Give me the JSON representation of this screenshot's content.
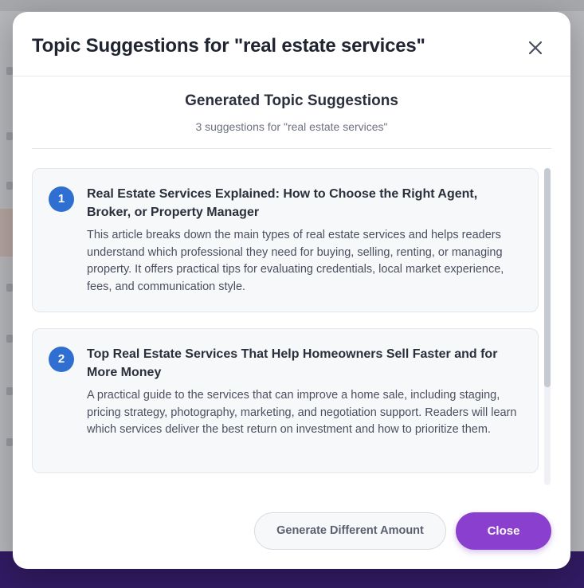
{
  "background": {
    "breadcrumb": "",
    "bottom_bar_color": "#3b1a7a"
  },
  "modal": {
    "title": "Topic Suggestions for \"real estate services\"",
    "close_icon": "close-icon",
    "section_title": "Generated Topic Suggestions",
    "section_subtitle": "3 suggestions for \"real estate services\"",
    "suggestions": [
      {
        "number": "1",
        "title": "Real Estate Services Explained: How to Choose the Right Agent, Broker, or Property Manager",
        "description": "This article breaks down the main types of real estate services and helps readers understand which professional they need for buying, selling, renting, or managing property. It offers practical tips for evaluating credentials, local market experience, fees, and communication style."
      },
      {
        "number": "2",
        "title": "Top Real Estate Services That Help Homeowners Sell Faster and for More Money",
        "description": "A practical guide to the services that can improve a home sale, including staging, pricing strategy, photography, marketing, and negotiation support. Readers will learn which services deliver the best return on investment and how to prioritize them."
      }
    ],
    "buttons": {
      "secondary_label": "Generate Different Amount",
      "primary_label": "Close"
    },
    "colors": {
      "accent": "#8a3fcf",
      "badge": "#2f6fd1"
    }
  }
}
